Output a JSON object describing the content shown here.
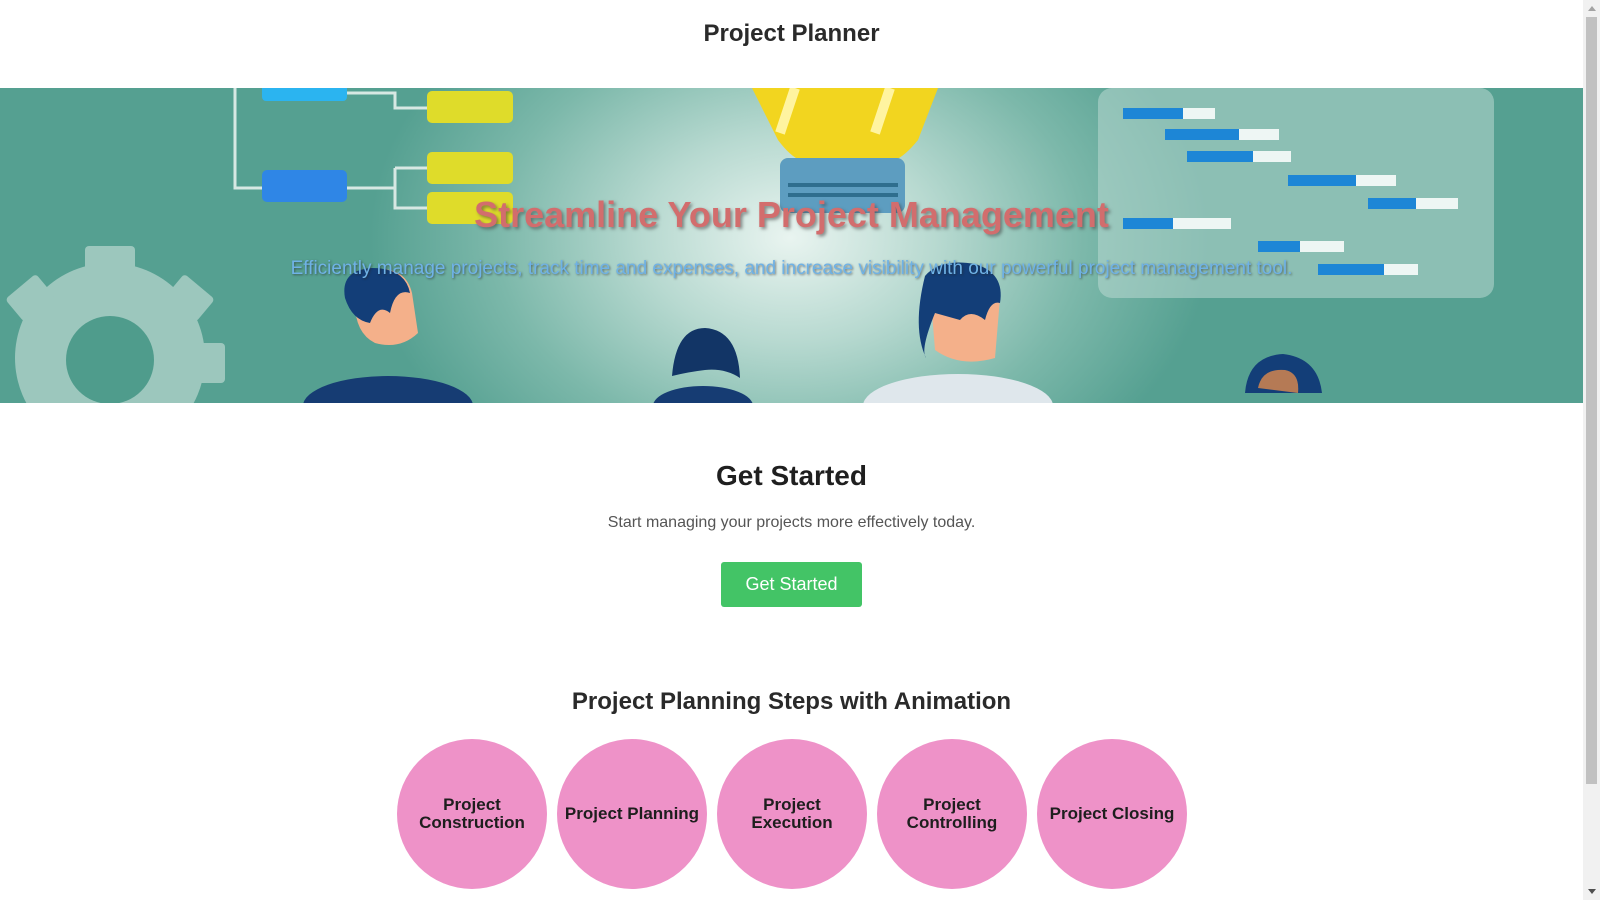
{
  "header": {
    "title": "Project Planner"
  },
  "hero": {
    "title": "Streamline Your Project Management",
    "subtitle": "Efficiently manage projects, track time and expenses, and increase visibility with our powerful project management tool."
  },
  "get_started": {
    "title": "Get Started",
    "text": "Start managing your projects more effectively today.",
    "button_label": "Get Started"
  },
  "steps": {
    "title": "Project Planning Steps with Animation",
    "items": [
      {
        "label": "Project Construction"
      },
      {
        "label": "Project Planning"
      },
      {
        "label": "Project Execution"
      },
      {
        "label": "Project Controlling"
      },
      {
        "label": "Project Closing"
      }
    ]
  },
  "colors": {
    "accent_button": "#43c466",
    "step_circle": "#ee92c8",
    "hero_title": "#d26d6d",
    "hero_subtitle": "#6fb2e6",
    "hero_background": "#55a091"
  },
  "icons": [
    "lightbulb-illustration",
    "gear-illustration",
    "flowchart-illustration",
    "gantt-chart-illustration",
    "people-illustration"
  ]
}
